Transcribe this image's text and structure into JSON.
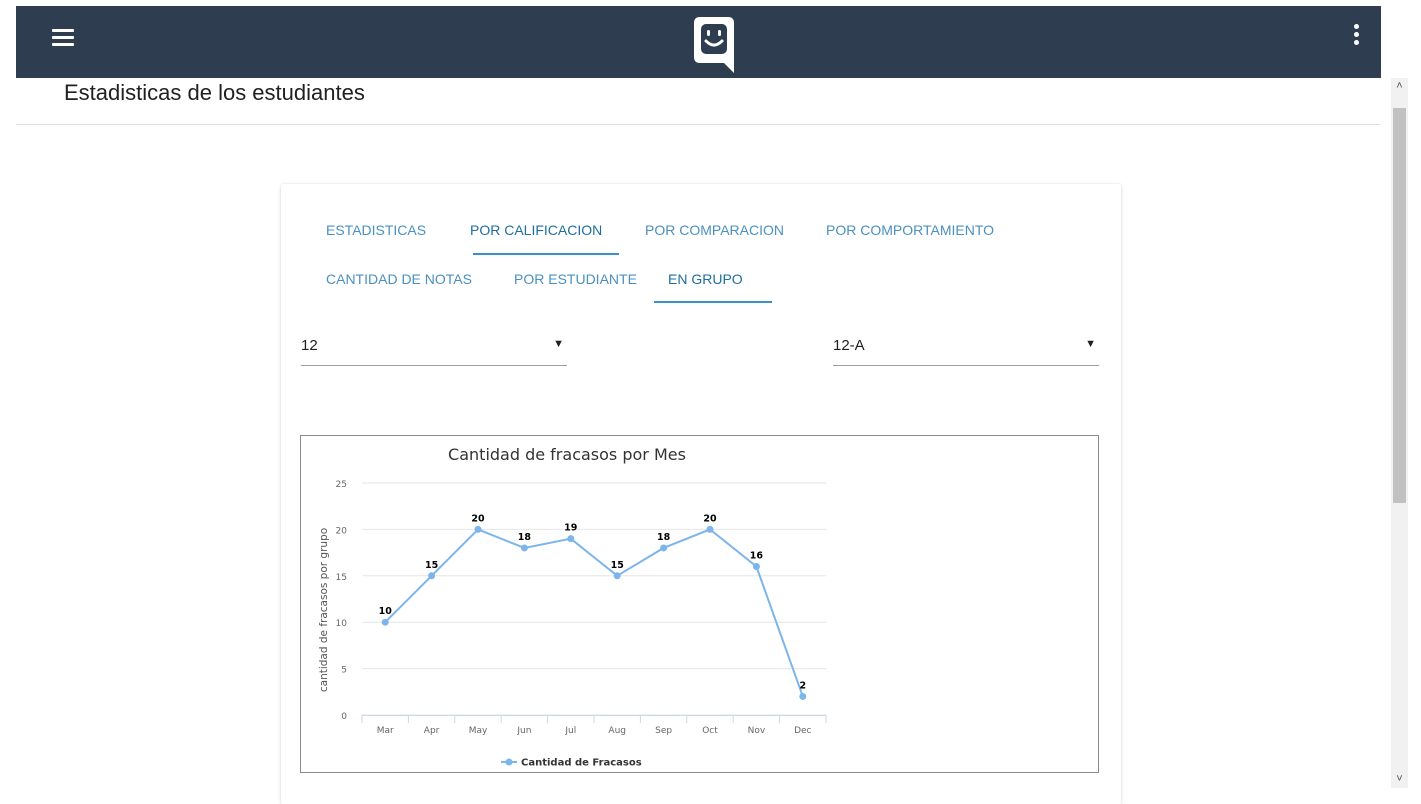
{
  "header": {
    "menu_icon": "hamburger-menu-icon",
    "logo_icon": "chat-bubble-smiley-logo",
    "overflow_icon": "vertical-dots-icon",
    "background_color": "#2e3e50"
  },
  "page": {
    "title": "Estadisticas de los estudiantes"
  },
  "tabs": [
    {
      "label": "ESTADISTICAS",
      "active": false
    },
    {
      "label": "POR CALIFICACION",
      "active": true
    },
    {
      "label": "POR COMPARACION",
      "active": false
    },
    {
      "label": "POR COMPORTAMIENTO",
      "active": false
    },
    {
      "label": "CANTIDAD DE NOTAS",
      "active": false
    },
    {
      "label": "POR ESTUDIANTE",
      "active": false
    },
    {
      "label": "EN GRUPO",
      "active": true
    }
  ],
  "filters": {
    "grade": {
      "value": "12"
    },
    "group": {
      "value": "12-A"
    }
  },
  "chart_data": {
    "type": "line",
    "title": "Cantidad de fracasos por Mes",
    "xlabel": "",
    "ylabel": "cantidad de fracasos por grupo",
    "categories": [
      "Mar",
      "Apr",
      "May",
      "Jun",
      "Jul",
      "Aug",
      "Sep",
      "Oct",
      "Nov",
      "Dec"
    ],
    "series": [
      {
        "name": "Cantidad de Fracasos",
        "values": [
          10,
          15,
          20,
          18,
          19,
          15,
          18,
          20,
          16,
          2
        ],
        "color": "#7cb5ec"
      }
    ],
    "ylim": [
      0,
      25
    ],
    "yticks": [
      0,
      5,
      10,
      15,
      20,
      25
    ],
    "grid": true,
    "data_labels": true,
    "legend": "bottom-center"
  }
}
